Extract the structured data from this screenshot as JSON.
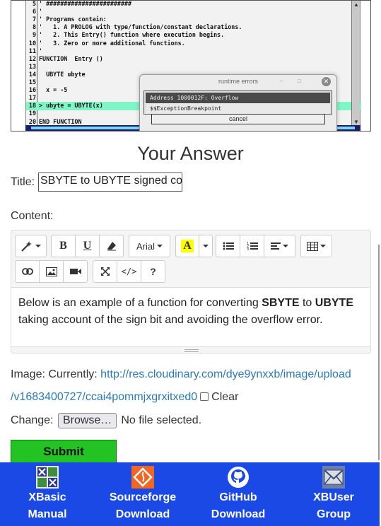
{
  "code_screenshot": {
    "lines": [
      {
        "num": "5",
        "text": "' ########################",
        "highlighted": false
      },
      {
        "num": "6",
        "text": "'",
        "highlighted": false
      },
      {
        "num": "7",
        "text": "' Programs contain:",
        "highlighted": false
      },
      {
        "num": "8",
        "text": "'   1. A PROLOG with type/function/constant declarations.",
        "highlighted": false
      },
      {
        "num": "9",
        "text": "'   2. This Entry() function where execution begins.",
        "highlighted": false
      },
      {
        "num": "10",
        "text": "'   3. Zero or more additional functions.",
        "highlighted": false
      },
      {
        "num": "11",
        "text": "'",
        "highlighted": false
      },
      {
        "num": "12",
        "text": "FUNCTION  Entry ()",
        "highlighted": false
      },
      {
        "num": "13",
        "text": "",
        "highlighted": false
      },
      {
        "num": "14",
        "text": "  UBYTE ubyte",
        "highlighted": false
      },
      {
        "num": "15",
        "text": "",
        "highlighted": false
      },
      {
        "num": "16",
        "text": "  x = -5",
        "highlighted": false
      },
      {
        "num": "17",
        "text": "",
        "highlighted": false
      },
      {
        "num": "18",
        "text": "> ubyte = UBYTE(x)",
        "highlighted": true
      },
      {
        "num": "19",
        "text": "",
        "highlighted": false
      },
      {
        "num": "20",
        "text": "END FUNCTION",
        "highlighted": false
      }
    ],
    "dialog": {
      "title": "runtime errors",
      "message_1": "Address 1000012F:  Overflow",
      "message_2": "$$ExceptionBreakpoint",
      "cancel_label": "cancel"
    }
  },
  "form": {
    "heading": "Your Answer",
    "title_label": "Title:",
    "title_value": "SBYTE to UBYTE signed co",
    "content_label": "Content:",
    "toolbar": {
      "font_name": "Arial",
      "highlight_letter": "A",
      "highlight_color": "#ffff00",
      "buttons": [
        "magic-style",
        "bold",
        "underline",
        "eraser",
        "font-name",
        "highlight-color",
        "unordered-list",
        "ordered-list",
        "paragraph-align",
        "table",
        "link",
        "picture",
        "video",
        "fullscreen",
        "code-view",
        "help"
      ]
    },
    "content": {
      "text_1": "Below is an example of a function for converting ",
      "bold_1": "SBYTE",
      "text_2": " to ",
      "bold_2": "UBYTE",
      "text_3": " taking account of the sign bit and avoiding the overflow error."
    },
    "image_label": "Image: Currently:",
    "image_url_line1": "http://res.cloudinary.com/dye9ynxxb/image/upload",
    "image_url_line2": "/v1683400727/ccai4pommjxgrxitxed0",
    "clear_label": "Clear",
    "change_label": "Change:",
    "browse_label": "Browse…",
    "no_file_label": "No file selected.",
    "submit_label": "Submit"
  },
  "footer": {
    "background": "#1a49e6",
    "items": [
      {
        "icon": "xbasic-icon",
        "line1": "XBasic",
        "line2": "Manual"
      },
      {
        "icon": "sourceforge-icon",
        "line1": "Sourceforge",
        "line2": "Download"
      },
      {
        "icon": "github-icon",
        "line1": "GitHub",
        "line2": "Download"
      },
      {
        "icon": "mail-icon",
        "line1": "XBUser",
        "line2": "Group"
      }
    ]
  }
}
